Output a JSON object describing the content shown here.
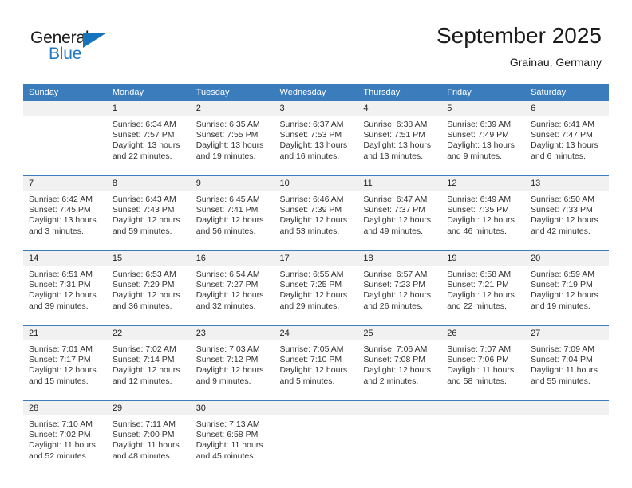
{
  "brand": {
    "word_general": "General",
    "word_blue": "Blue"
  },
  "header": {
    "title": "September 2025",
    "subtitle": "Grainau, Germany"
  },
  "colors": {
    "header_blue": "#3b7cbd",
    "brand_blue": "#2079c4",
    "daynum_bg": "#f1f1f1",
    "text": "#222222"
  },
  "weekday_headers": [
    "Sunday",
    "Monday",
    "Tuesday",
    "Wednesday",
    "Thursday",
    "Friday",
    "Saturday"
  ],
  "weeks": [
    [
      {
        "day": "",
        "sunrise": "",
        "sunset": "",
        "daylight": "",
        "daylight2": ""
      },
      {
        "day": "1",
        "sunrise": "Sunrise: 6:34 AM",
        "sunset": "Sunset: 7:57 PM",
        "daylight": "Daylight: 13 hours",
        "daylight2": "and 22 minutes."
      },
      {
        "day": "2",
        "sunrise": "Sunrise: 6:35 AM",
        "sunset": "Sunset: 7:55 PM",
        "daylight": "Daylight: 13 hours",
        "daylight2": "and 19 minutes."
      },
      {
        "day": "3",
        "sunrise": "Sunrise: 6:37 AM",
        "sunset": "Sunset: 7:53 PM",
        "daylight": "Daylight: 13 hours",
        "daylight2": "and 16 minutes."
      },
      {
        "day": "4",
        "sunrise": "Sunrise: 6:38 AM",
        "sunset": "Sunset: 7:51 PM",
        "daylight": "Daylight: 13 hours",
        "daylight2": "and 13 minutes."
      },
      {
        "day": "5",
        "sunrise": "Sunrise: 6:39 AM",
        "sunset": "Sunset: 7:49 PM",
        "daylight": "Daylight: 13 hours",
        "daylight2": "and 9 minutes."
      },
      {
        "day": "6",
        "sunrise": "Sunrise: 6:41 AM",
        "sunset": "Sunset: 7:47 PM",
        "daylight": "Daylight: 13 hours",
        "daylight2": "and 6 minutes."
      }
    ],
    [
      {
        "day": "7",
        "sunrise": "Sunrise: 6:42 AM",
        "sunset": "Sunset: 7:45 PM",
        "daylight": "Daylight: 13 hours",
        "daylight2": "and 3 minutes."
      },
      {
        "day": "8",
        "sunrise": "Sunrise: 6:43 AM",
        "sunset": "Sunset: 7:43 PM",
        "daylight": "Daylight: 12 hours",
        "daylight2": "and 59 minutes."
      },
      {
        "day": "9",
        "sunrise": "Sunrise: 6:45 AM",
        "sunset": "Sunset: 7:41 PM",
        "daylight": "Daylight: 12 hours",
        "daylight2": "and 56 minutes."
      },
      {
        "day": "10",
        "sunrise": "Sunrise: 6:46 AM",
        "sunset": "Sunset: 7:39 PM",
        "daylight": "Daylight: 12 hours",
        "daylight2": "and 53 minutes."
      },
      {
        "day": "11",
        "sunrise": "Sunrise: 6:47 AM",
        "sunset": "Sunset: 7:37 PM",
        "daylight": "Daylight: 12 hours",
        "daylight2": "and 49 minutes."
      },
      {
        "day": "12",
        "sunrise": "Sunrise: 6:49 AM",
        "sunset": "Sunset: 7:35 PM",
        "daylight": "Daylight: 12 hours",
        "daylight2": "and 46 minutes."
      },
      {
        "day": "13",
        "sunrise": "Sunrise: 6:50 AM",
        "sunset": "Sunset: 7:33 PM",
        "daylight": "Daylight: 12 hours",
        "daylight2": "and 42 minutes."
      }
    ],
    [
      {
        "day": "14",
        "sunrise": "Sunrise: 6:51 AM",
        "sunset": "Sunset: 7:31 PM",
        "daylight": "Daylight: 12 hours",
        "daylight2": "and 39 minutes."
      },
      {
        "day": "15",
        "sunrise": "Sunrise: 6:53 AM",
        "sunset": "Sunset: 7:29 PM",
        "daylight": "Daylight: 12 hours",
        "daylight2": "and 36 minutes."
      },
      {
        "day": "16",
        "sunrise": "Sunrise: 6:54 AM",
        "sunset": "Sunset: 7:27 PM",
        "daylight": "Daylight: 12 hours",
        "daylight2": "and 32 minutes."
      },
      {
        "day": "17",
        "sunrise": "Sunrise: 6:55 AM",
        "sunset": "Sunset: 7:25 PM",
        "daylight": "Daylight: 12 hours",
        "daylight2": "and 29 minutes."
      },
      {
        "day": "18",
        "sunrise": "Sunrise: 6:57 AM",
        "sunset": "Sunset: 7:23 PM",
        "daylight": "Daylight: 12 hours",
        "daylight2": "and 26 minutes."
      },
      {
        "day": "19",
        "sunrise": "Sunrise: 6:58 AM",
        "sunset": "Sunset: 7:21 PM",
        "daylight": "Daylight: 12 hours",
        "daylight2": "and 22 minutes."
      },
      {
        "day": "20",
        "sunrise": "Sunrise: 6:59 AM",
        "sunset": "Sunset: 7:19 PM",
        "daylight": "Daylight: 12 hours",
        "daylight2": "and 19 minutes."
      }
    ],
    [
      {
        "day": "21",
        "sunrise": "Sunrise: 7:01 AM",
        "sunset": "Sunset: 7:17 PM",
        "daylight": "Daylight: 12 hours",
        "daylight2": "and 15 minutes."
      },
      {
        "day": "22",
        "sunrise": "Sunrise: 7:02 AM",
        "sunset": "Sunset: 7:14 PM",
        "daylight": "Daylight: 12 hours",
        "daylight2": "and 12 minutes."
      },
      {
        "day": "23",
        "sunrise": "Sunrise: 7:03 AM",
        "sunset": "Sunset: 7:12 PM",
        "daylight": "Daylight: 12 hours",
        "daylight2": "and 9 minutes."
      },
      {
        "day": "24",
        "sunrise": "Sunrise: 7:05 AM",
        "sunset": "Sunset: 7:10 PM",
        "daylight": "Daylight: 12 hours",
        "daylight2": "and 5 minutes."
      },
      {
        "day": "25",
        "sunrise": "Sunrise: 7:06 AM",
        "sunset": "Sunset: 7:08 PM",
        "daylight": "Daylight: 12 hours",
        "daylight2": "and 2 minutes."
      },
      {
        "day": "26",
        "sunrise": "Sunrise: 7:07 AM",
        "sunset": "Sunset: 7:06 PM",
        "daylight": "Daylight: 11 hours",
        "daylight2": "and 58 minutes."
      },
      {
        "day": "27",
        "sunrise": "Sunrise: 7:09 AM",
        "sunset": "Sunset: 7:04 PM",
        "daylight": "Daylight: 11 hours",
        "daylight2": "and 55 minutes."
      }
    ],
    [
      {
        "day": "28",
        "sunrise": "Sunrise: 7:10 AM",
        "sunset": "Sunset: 7:02 PM",
        "daylight": "Daylight: 11 hours",
        "daylight2": "and 52 minutes."
      },
      {
        "day": "29",
        "sunrise": "Sunrise: 7:11 AM",
        "sunset": "Sunset: 7:00 PM",
        "daylight": "Daylight: 11 hours",
        "daylight2": "and 48 minutes."
      },
      {
        "day": "30",
        "sunrise": "Sunrise: 7:13 AM",
        "sunset": "Sunset: 6:58 PM",
        "daylight": "Daylight: 11 hours",
        "daylight2": "and 45 minutes."
      },
      {
        "day": "",
        "sunrise": "",
        "sunset": "",
        "daylight": "",
        "daylight2": ""
      },
      {
        "day": "",
        "sunrise": "",
        "sunset": "",
        "daylight": "",
        "daylight2": ""
      },
      {
        "day": "",
        "sunrise": "",
        "sunset": "",
        "daylight": "",
        "daylight2": ""
      },
      {
        "day": "",
        "sunrise": "",
        "sunset": "",
        "daylight": "",
        "daylight2": ""
      }
    ]
  ]
}
